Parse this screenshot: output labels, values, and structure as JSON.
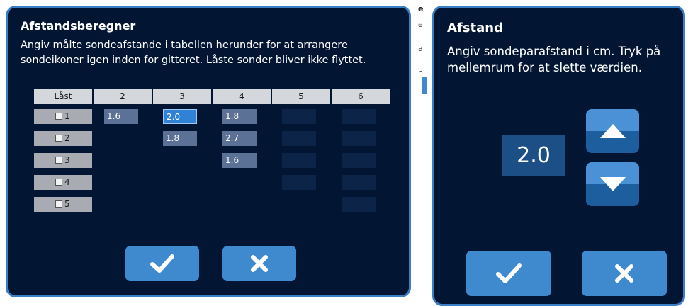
{
  "left_dialog": {
    "title": "Afstandsberegner",
    "description": "Angiv målte sondeafstande i tabellen herunder for at arrangere sondeikoner igen inden for gitteret. Låste sonder bliver ikke flyttet.",
    "table": {
      "headers": [
        "Låst",
        "2",
        "3",
        "4",
        "5",
        "6"
      ],
      "rows": [
        {
          "label": "1",
          "cells": [
            "1.6",
            "2.0",
            "1.8",
            "",
            ""
          ]
        },
        {
          "label": "2",
          "cells": [
            "",
            "1.8",
            "2.7",
            "",
            ""
          ]
        },
        {
          "label": "3",
          "cells": [
            "",
            "",
            "1.6",
            "",
            ""
          ]
        },
        {
          "label": "4",
          "cells": [
            "",
            "",
            "",
            "",
            ""
          ]
        },
        {
          "label": "5",
          "cells": [
            "",
            "",
            "",
            "",
            ""
          ]
        }
      ],
      "selected_cell": "row 1, column 3"
    },
    "confirm_icon": "checkmark-icon",
    "cancel_icon": "x-icon"
  },
  "right_dialog": {
    "title": "Afstand",
    "description": "Angiv sondeparafstand i cm. Tryk på mellemrum for at slette værdien.",
    "value": "2.0",
    "up_icon": "arrow-up-icon",
    "down_icon": "arrow-down-icon",
    "confirm_icon": "checkmark-icon",
    "cancel_icon": "x-icon"
  },
  "colors": {
    "dialog_bg": "#021634",
    "dialog_border": "#3a7fc4",
    "button": "#3f89cf",
    "header_cell": "#d4d7dc",
    "row_label": "#a8abb1",
    "value_cell": "#5b7296",
    "selected_cell": "#2f82d6",
    "empty_cell": "#0d2449"
  },
  "edge_fragments": [
    "e",
    "e",
    "a",
    "n"
  ]
}
